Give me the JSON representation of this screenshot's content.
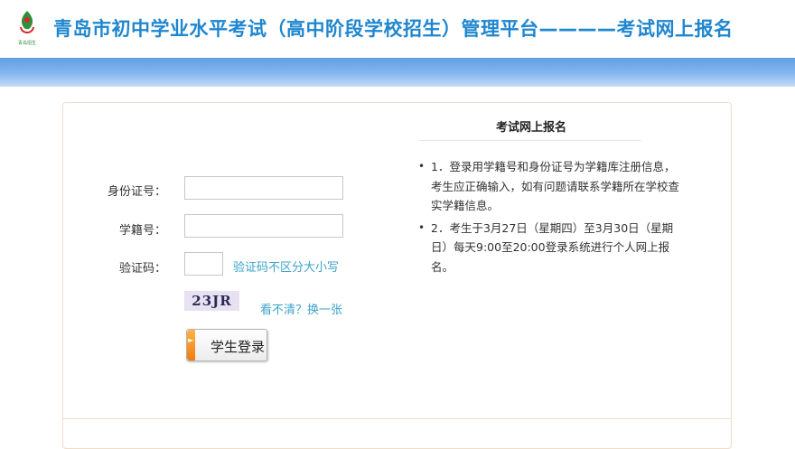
{
  "header": {
    "title": "青岛市初中学业水平考试（高中阶段学校招生）管理平台————考试网上报名",
    "logo_text": "青岛招生"
  },
  "form": {
    "id_label": "身份证号：",
    "id_value": "",
    "student_no_label": "学籍号：",
    "student_no_value": "",
    "captcha_label": "验证码：",
    "captcha_value": "",
    "captcha_hint": "验证码不区分大小写",
    "captcha_image_text": "23JR",
    "refresh_link": "看不清？换一张",
    "login_button": "学生登录"
  },
  "notice": {
    "title": "考试网上报名",
    "items": [
      "1．登录用学籍号和身份证号为学籍库注册信息，考生应正确输入，如有问题请联系学籍所在学校查实学籍信息。",
      "2．考生于3月27日（星期四）至3月30日（星期日）每天9:00至20:00登录系统进行个人网上报名。"
    ]
  },
  "colors": {
    "title": "#1f86cf",
    "band_top": "#5f9ee4",
    "band_bottom": "#c6ddf6",
    "hint": "#3ba3c9",
    "panel_border": "#f0dcc8",
    "button_accent": "#f07c0f"
  }
}
